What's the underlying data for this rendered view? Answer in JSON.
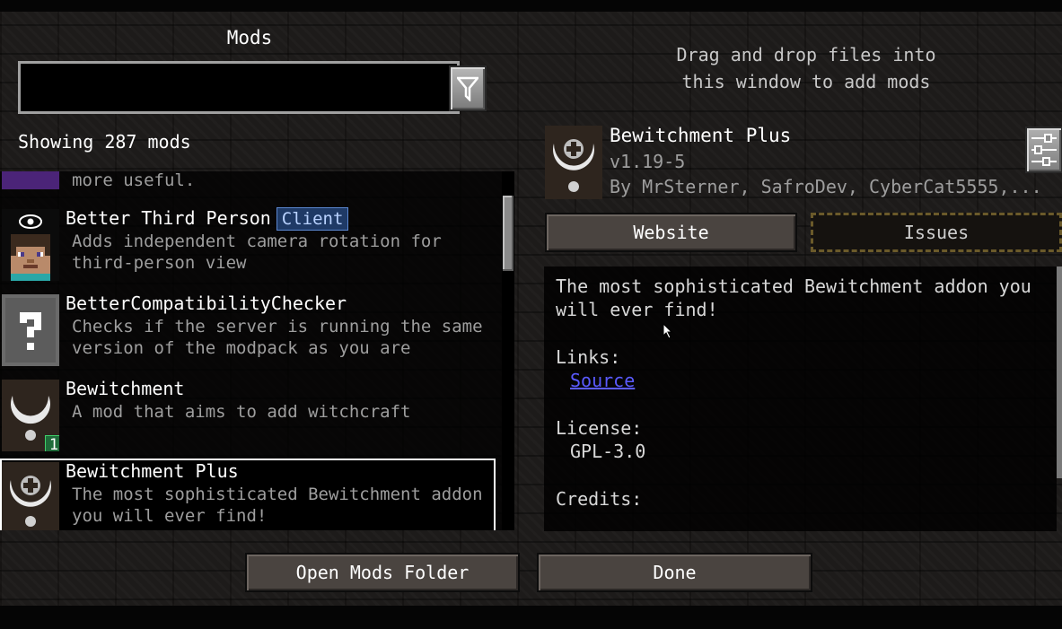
{
  "header": {
    "title": "Mods",
    "search": {
      "value": "",
      "placeholder": ""
    },
    "filter_icon": "filter-funnel-icon",
    "showing_count": "Showing 287 mods"
  },
  "drag_drop_hint": "Drag and drop files into\nthis window to add mods",
  "mod_list": {
    "partial_top_desc": "more useful.",
    "items": [
      {
        "name": "Better Third Person",
        "tag": "Client",
        "description": "Adds independent camera rotation for third-person view",
        "icon": "steve-face-icon"
      },
      {
        "name": "BetterCompatibilityChecker",
        "description": "Checks if the server is running the same version of the modpack as you are",
        "icon": "question-mark-icon"
      },
      {
        "name": "Bewitchment",
        "description": "A mod that aims to add witchcraft",
        "badge": "1",
        "icon": "crescent-pendant-icon"
      },
      {
        "name": "Bewitchment Plus",
        "description": "The most sophisticated Bewitchment addon you will ever find!",
        "icon": "crescent-cross-pendant-icon",
        "selected": true
      }
    ]
  },
  "detail": {
    "name": "Bewitchment Plus",
    "version": "v1.19-5",
    "authors": "By MrSterner, SafroDev, CyberCat5555,...",
    "config_icon": "sliders-config-icon",
    "website_label": "Website",
    "issues_label": "Issues",
    "summary": "The most sophisticated Bewitchment addon you will ever find!",
    "links_heading": "Links:",
    "source_link": "Source",
    "license_heading": "License:",
    "license_value": "GPL-3.0",
    "credits_heading": "Credits:"
  },
  "footer": {
    "open_folder_label": "Open Mods Folder",
    "done_label": "Done"
  },
  "colors": {
    "link": "#5a5aff",
    "client_tag_bg": "#1f3a66",
    "badge_bg": "#1f6b3a"
  }
}
